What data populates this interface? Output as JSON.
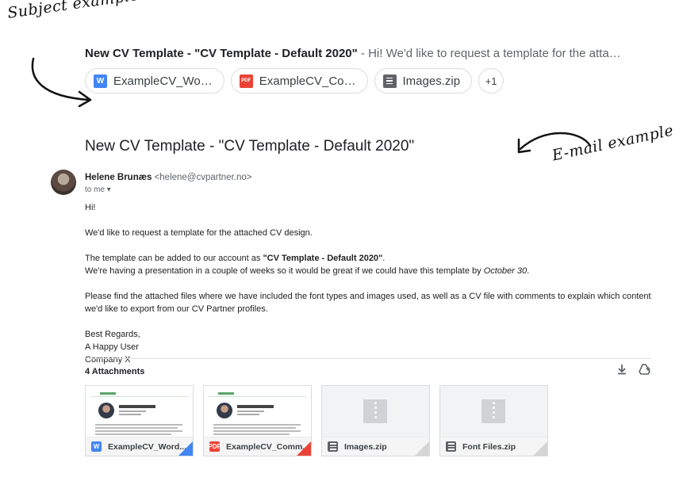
{
  "annotations": {
    "subject_label": "Subject example",
    "email_label": "E-mail example"
  },
  "subject_row": {
    "subject": "New CV Template - \"CV Template - Default 2020\"",
    "snippet": " - Hi! We'd like to request a template for the attac…",
    "chips": [
      {
        "label": "ExampleCV_Wo…",
        "icon": "word-doc-icon"
      },
      {
        "label": "ExampleCV_Co…",
        "icon": "pdf-icon"
      },
      {
        "label": "Images.zip",
        "icon": "zip-icon"
      }
    ],
    "more_label": "+1"
  },
  "email": {
    "title": "New CV Template - \"CV Template - Default 2020\"",
    "sender_name": "Helene Brunæs",
    "sender_email": "<helene@cvpartner.no>",
    "to": "to me",
    "greeting": "Hi!",
    "para1": "We'd like to request a template for the attached CV design.",
    "para2_pre": "The template can be added to our account as ",
    "para2_bold": "\"CV Template - Default 2020\"",
    "para2_post": ".",
    "para2_line2_pre": "We're having a presentation in a couple of weeks so it would be great if we could have this template by ",
    "para2_line2_italic": "October 30",
    "para2_line2_post": ".",
    "para3": "Please find the attached files where we have included the font types and images used, as well as a CV file with comments to explain which content we'd like to export from our CV Partner profiles.",
    "sign1": "Best Regards,",
    "sign2": "A Happy User",
    "sign3": "Company X"
  },
  "attachments": {
    "title": "4 Attachments",
    "items": [
      {
        "name": "ExampleCV_Word....",
        "type": "word"
      },
      {
        "name": "ExampleCV_Comm...",
        "type": "pdf"
      },
      {
        "name": "Images.zip",
        "type": "zip"
      },
      {
        "name": "Font Files.zip",
        "type": "zip"
      }
    ]
  },
  "colors": {
    "word": "#4285f4",
    "pdf": "#ea4335",
    "zip": "#5f6368"
  }
}
